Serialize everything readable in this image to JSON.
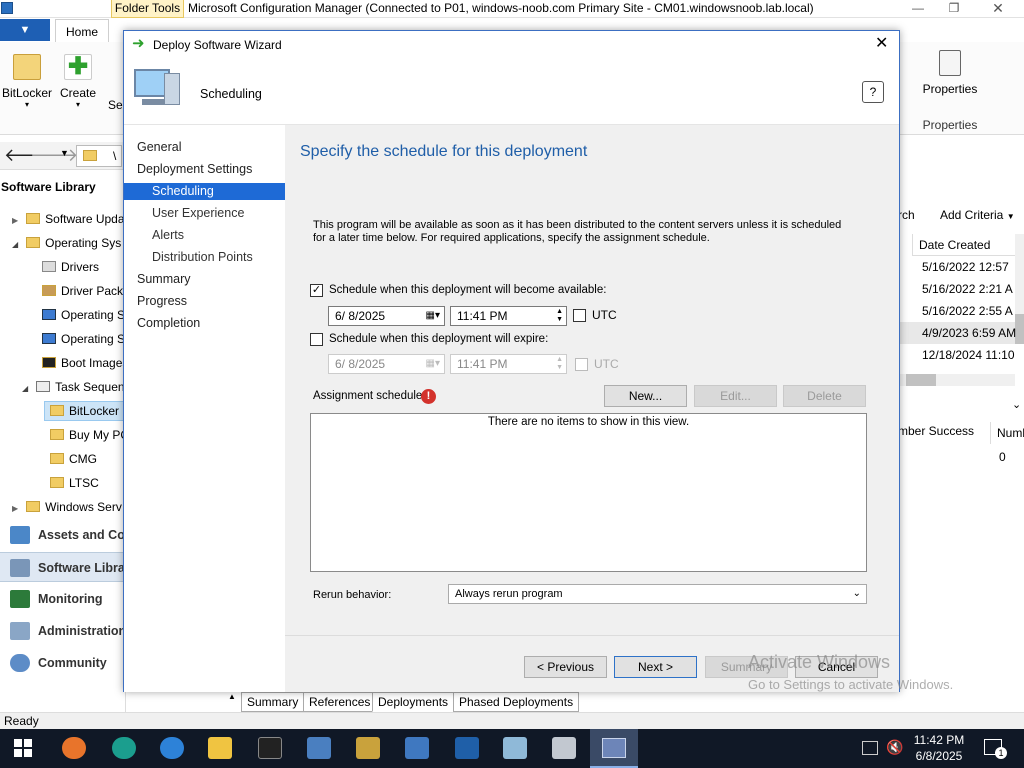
{
  "window": {
    "folder_tools": "Folder Tools",
    "title": "Microsoft Configuration Manager (Connected to P01, windows-noob.com Primary Site - CM01.windowsnoob.lab.local)",
    "help_count": "1"
  },
  "ribbon": {
    "home_tab": "Home",
    "bitlocker": "BitLocker",
    "create": "Create",
    "se": "Se",
    "properties": "Properties",
    "properties_group": "Properties"
  },
  "address": {
    "path_sep": "\\"
  },
  "nav": {
    "title": "Software Library",
    "items": [
      {
        "label": "Software Upda"
      },
      {
        "label": "Operating Sys"
      },
      {
        "label": "Drivers"
      },
      {
        "label": "Driver Packa"
      },
      {
        "label": "Operating S"
      },
      {
        "label": "Operating S"
      },
      {
        "label": "Boot Images"
      },
      {
        "label": "Task Sequen"
      },
      {
        "label": "BitLocker"
      },
      {
        "label": "Buy My PC"
      },
      {
        "label": "CMG"
      },
      {
        "label": "LTSC"
      },
      {
        "label": "Windows Serv"
      }
    ],
    "workspaces": [
      {
        "label": "Assets and Com"
      },
      {
        "label": "Software Library"
      },
      {
        "label": "Monitoring"
      },
      {
        "label": "Administration"
      },
      {
        "label": "Community"
      }
    ]
  },
  "right_panel": {
    "search_frag": "rch",
    "add_criteria": "Add Criteria",
    "date_created_header": "Date Created",
    "dates": [
      "5/16/2022 12:57",
      "5/16/2022 2:21 A",
      "5/16/2022 2:55 A",
      "4/9/2023 6:59 AM",
      "12/18/2024 11:10"
    ],
    "success_header": "mber Success",
    "num_header": "Numb",
    "success_value": "0"
  },
  "bottom_tabs": [
    "Summary",
    "References",
    "Deployments",
    "Phased Deployments"
  ],
  "status": "Ready",
  "watermark": {
    "line1": "Activate Windows",
    "line2": "Go to Settings to activate Windows."
  },
  "taskbar": {
    "time": "11:42 PM",
    "date": "6/8/2025",
    "notif_count": "1"
  },
  "wizard": {
    "title": "Deploy Software Wizard",
    "banner": "Scheduling",
    "steps": {
      "general": "General",
      "deployment_settings": "Deployment Settings",
      "scheduling": "Scheduling",
      "user_experience": "User Experience",
      "alerts": "Alerts",
      "distribution_points": "Distribution Points",
      "summary": "Summary",
      "progress": "Progress",
      "completion": "Completion"
    },
    "heading": "Specify the schedule for this deployment",
    "description": "This program will be available as soon as it has been distributed to the content servers unless it is scheduled for a later time below. For required applications, specify the assignment schedule.",
    "available_label": "Schedule when this deployment will become available:",
    "available_date": "6/  8/2025",
    "available_time": "11:41 PM",
    "utc": "UTC",
    "expire_label": "Schedule when this deployment will expire:",
    "expire_date": "6/  8/2025",
    "expire_time": "11:41 PM",
    "utc2": "UTC",
    "assignment_label": "Assignment schedule:",
    "new_btn": "New...",
    "edit_btn": "Edit...",
    "delete_btn": "Delete",
    "empty_list": "There are no items to show in this view.",
    "rerun_label": "Rerun behavior:",
    "rerun_value": "Always rerun program",
    "previous_btn": "< Previous",
    "next_btn": "Next >",
    "summary_btn": "Summary",
    "cancel_btn": "Cancel"
  }
}
